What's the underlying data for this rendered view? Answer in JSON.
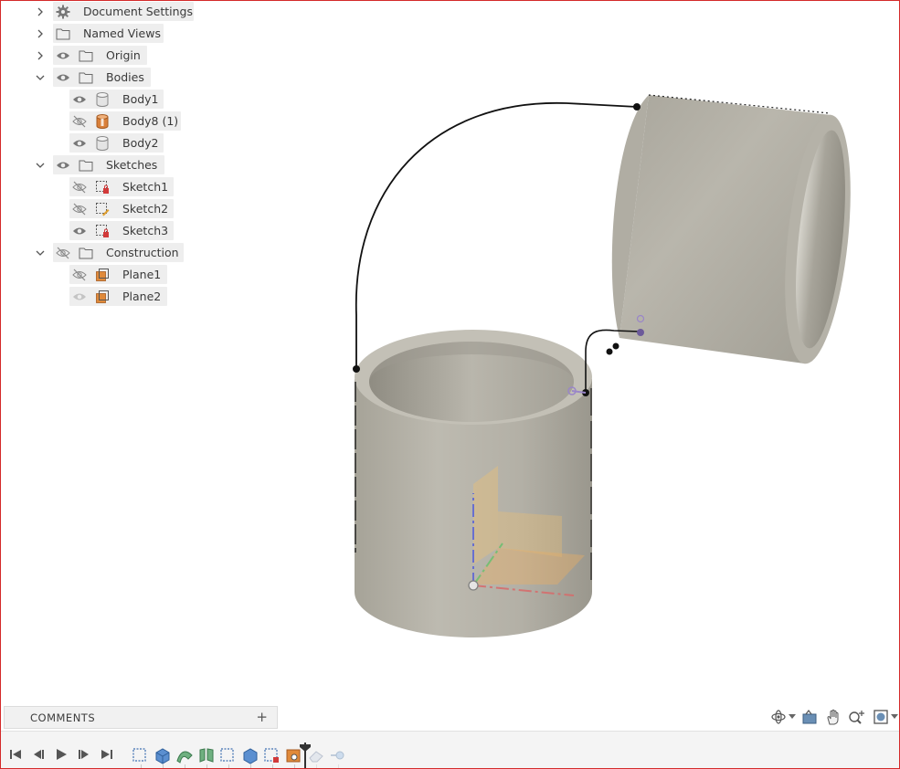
{
  "browser": {
    "items": [
      {
        "label": "Document Settings",
        "expanded": false,
        "icon": "gear-icon"
      },
      {
        "label": "Named Views",
        "expanded": false,
        "icon": "folder-icon"
      },
      {
        "label": "Origin",
        "expanded": false,
        "icon": "folder-icon",
        "visible": true
      },
      {
        "label": "Bodies",
        "expanded": true,
        "icon": "folder-icon",
        "visible": true
      },
      {
        "label": "Body1",
        "icon": "body-icon",
        "visible": true
      },
      {
        "label": "Body8 (1)",
        "icon": "body-orange-icon",
        "visible": false
      },
      {
        "label": "Body2",
        "icon": "body-icon",
        "visible": true
      },
      {
        "label": "Sketches",
        "expanded": true,
        "icon": "folder-icon",
        "visible": true
      },
      {
        "label": "Sketch1",
        "icon": "sketch-locked-icon",
        "visible": false
      },
      {
        "label": "Sketch2",
        "icon": "sketch-edit-icon",
        "visible": false
      },
      {
        "label": "Sketch3",
        "icon": "sketch-locked-icon",
        "visible": true
      },
      {
        "label": "Construction",
        "expanded": true,
        "icon": "folder-icon",
        "visible": false
      },
      {
        "label": "Plane1",
        "icon": "plane-icon",
        "visible": false
      },
      {
        "label": "Plane2",
        "icon": "plane-icon",
        "visible": "faded"
      }
    ]
  },
  "comments": {
    "title": "COMMENTS",
    "add": "+"
  },
  "colors": {
    "body": "#b8b5aa",
    "accent": "#e08a3a",
    "frame": "#d42a2a"
  }
}
